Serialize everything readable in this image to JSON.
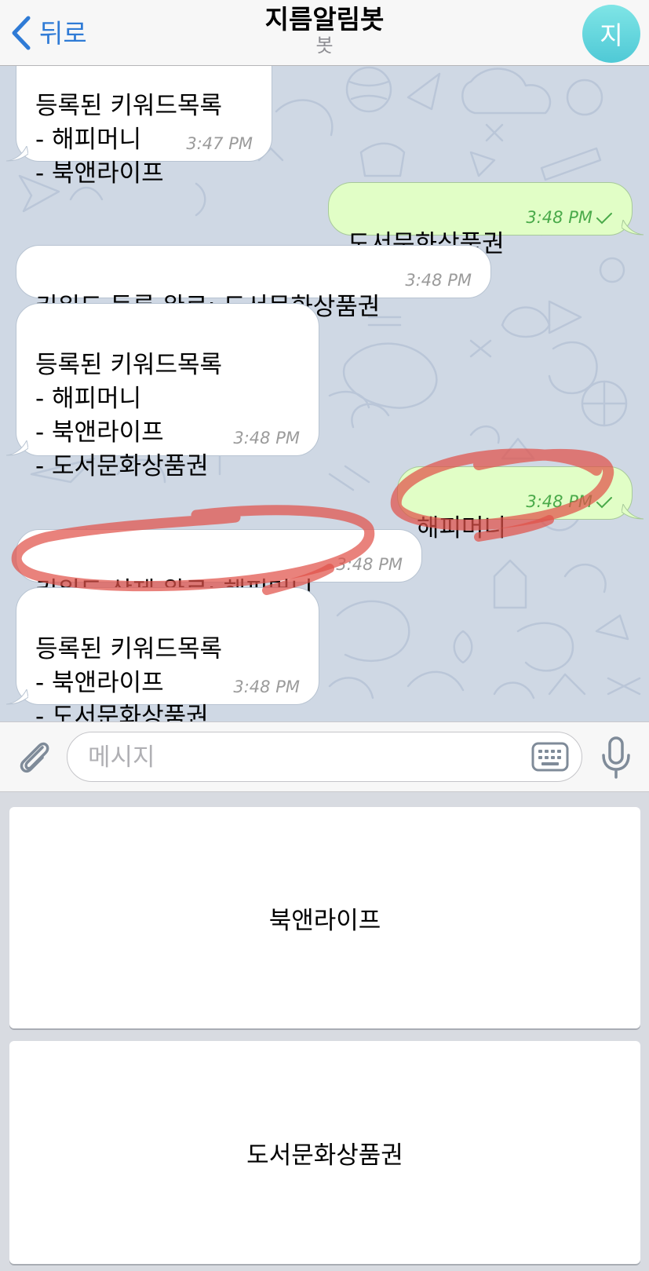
{
  "header": {
    "back_label": "뒤로",
    "title": "지름알림봇",
    "subtitle": "봇",
    "avatar_letter": "지",
    "avatar_color": "#5fd3dc",
    "accent_color": "#2f7bd6"
  },
  "messages": [
    {
      "dir": "in",
      "text": "등록된 키워드목록\n- 해피머니\n- 북앤라이프",
      "time": "3:47 PM"
    },
    {
      "dir": "out",
      "text": "도서문화상품권",
      "time": "3:48 PM",
      "read": true
    },
    {
      "dir": "in",
      "text": "키워드 등록 완료: 도서문화상품권",
      "time": "3:48 PM"
    },
    {
      "dir": "in",
      "text": "등록된 키워드목록\n- 해피머니\n- 북앤라이프\n- 도서문화상품권",
      "time": "3:48 PM"
    },
    {
      "dir": "out",
      "text": "해피머니",
      "time": "3:48 PM",
      "read": true
    },
    {
      "dir": "in",
      "text": "키워드 삭제 완료: 해피머니",
      "time": "3:48 PM"
    },
    {
      "dir": "in",
      "text": "등록된 키워드목록\n- 북앤라이프\n- 도서문화상품권",
      "time": "3:48 PM"
    }
  ],
  "input": {
    "placeholder": "메시지"
  },
  "keyboard_buttons": [
    "북앤라이프",
    "도서문화상품권"
  ],
  "icons": [
    "chevron-left-icon",
    "paperclip-icon",
    "keyboard-icon",
    "microphone-icon",
    "checkmark-icon"
  ],
  "colors": {
    "incoming_bubble": "#ffffff",
    "outgoing_bubble": "#e1fec6",
    "outgoing_time": "#4aaa4a",
    "chat_background": "#cfd8e4",
    "annotation_stroke": "#e0524a"
  }
}
